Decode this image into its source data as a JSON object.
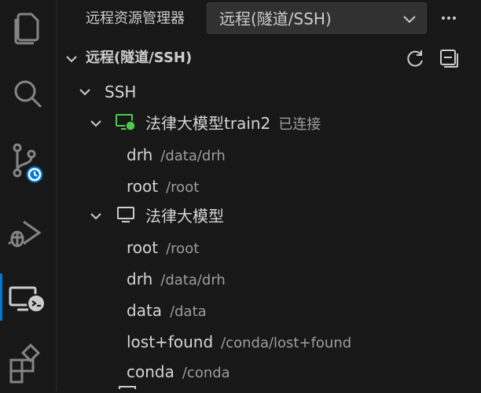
{
  "header": {
    "panel_title": "远程资源管理器",
    "selected_view": "远程(隧道/SSH)"
  },
  "section": {
    "title": "远程(隧道/SSH)"
  },
  "tree": {
    "group_label": "SSH",
    "host1": {
      "name": "法律大模型train2",
      "status": "已连接",
      "folders": [
        {
          "name": "drh",
          "path": "/data/drh"
        },
        {
          "name": "root",
          "path": "/root"
        }
      ]
    },
    "host2": {
      "name": "法律大模型",
      "folders": [
        {
          "name": "root",
          "path": "/root"
        },
        {
          "name": "drh",
          "path": "/data/drh"
        },
        {
          "name": "data",
          "path": "/data"
        },
        {
          "name": "lost+found",
          "path": "/conda/lost+found"
        },
        {
          "name": "conda",
          "path": "/conda"
        }
      ]
    }
  },
  "colors": {
    "accent": "#0078d4",
    "connected": "#4ec94e",
    "background": "#181818"
  },
  "icons": {
    "activity_bar": [
      "explorer-icon",
      "search-icon",
      "source-control-icon",
      "run-debug-icon",
      "remote-explorer-icon",
      "extensions-icon"
    ]
  }
}
